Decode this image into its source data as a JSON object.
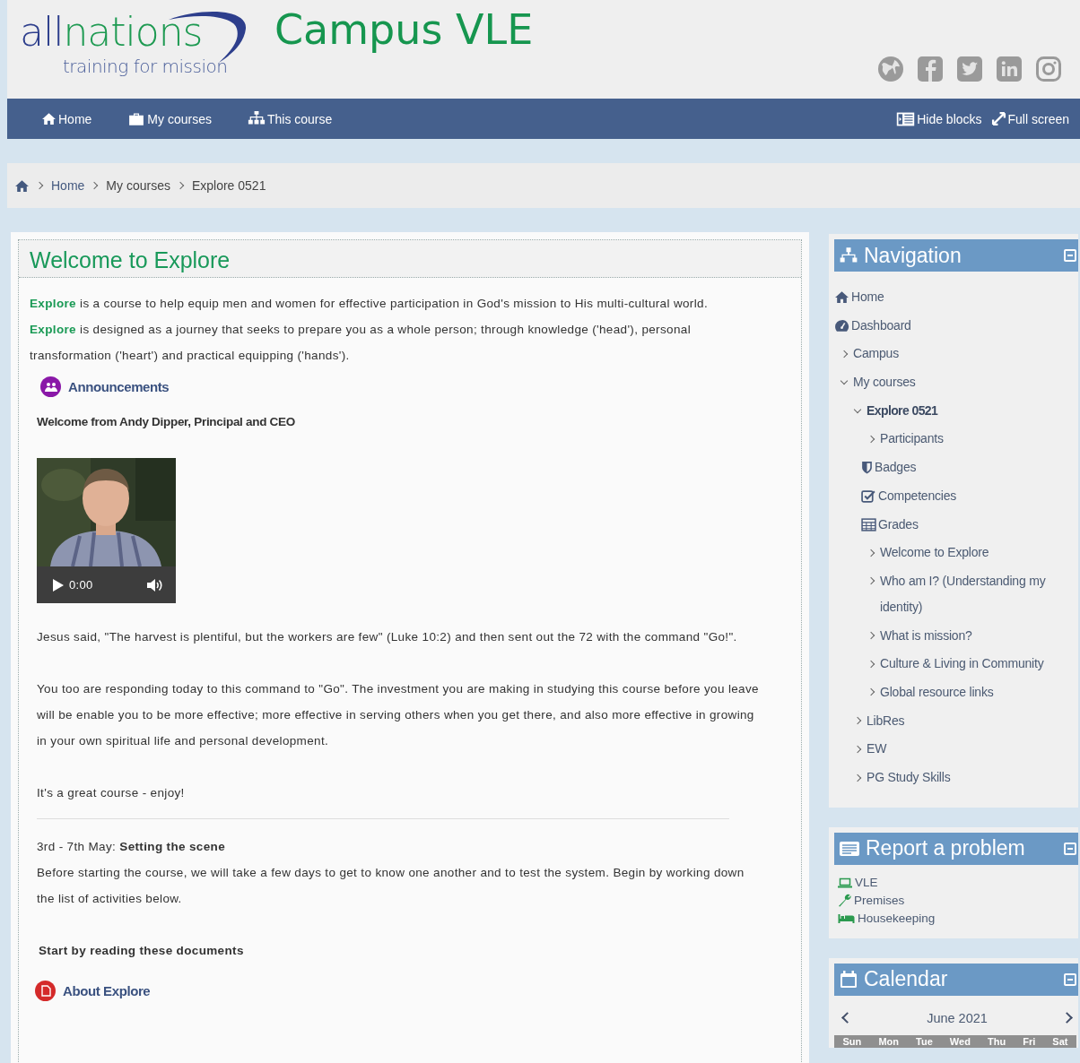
{
  "header": {
    "logo_first": "all",
    "logo_second": "nations",
    "tagline": "training for mission",
    "site_title": "Campus VLE"
  },
  "navbar": {
    "left": [
      {
        "label": "Home",
        "kind": "home"
      },
      {
        "label": "My courses",
        "kind": "briefcase"
      },
      {
        "label": "This course",
        "kind": "sitemap"
      }
    ],
    "right": [
      {
        "label": "Hide blocks",
        "kind": "blocks"
      },
      {
        "label": "Full screen",
        "kind": "expand"
      }
    ]
  },
  "breadcrumb": [
    "Home",
    "My courses",
    "Explore 0521"
  ],
  "course": {
    "title": "Welcome to Explore",
    "intro": [
      "**Explore** is a course to help equip men and women for effective participation in God's mission to His multi-cultural world.",
      "**Explore** is designed as a journey that seeks to prepare you as a whole person; through knowledge ('head'), personal transformation ('heart') and practical equipping ('hands')."
    ],
    "announcements": "Announcements",
    "welcome_heading": "Welcome from Andy Dipper, Principal and CEO",
    "video": {
      "time": "0:00"
    },
    "paragraphs": [
      "Jesus said, \"The harvest is plentiful, but the workers are few\" (Luke 10:2) and then sent out the 72 with the command \"Go!\".",
      "You too are responding today to this command to \"Go\".  The investment you are making in studying this course before you leave will be enable you to be more effective; more effective in serving others when you get there, and also more effective in growing in your own spiritual life and personal development.",
      "It's a great course - enjoy!"
    ],
    "section_heading": "3rd - 7th May: **Setting the scene**",
    "section_text": "Before starting the course, we will take a few days to get to know one another and to test the system. Begin by working down the list of activities below.",
    "start_heading": "Start by reading these documents",
    "document": "About Explore"
  },
  "navigation": {
    "title": "Navigation",
    "items": [
      {
        "label": "Home",
        "kind": "home",
        "selected": false
      },
      {
        "label": "Dashboard",
        "kind": "dashboard",
        "selected": false
      },
      {
        "label": "Campus",
        "kind": "branch",
        "expanded": false,
        "selected": false
      },
      {
        "label": "My courses",
        "kind": "branch",
        "expanded": true,
        "selected": false,
        "children": [
          {
            "label": "Explore 0521",
            "kind": "branch",
            "expanded": true,
            "selected": true,
            "children": [
              {
                "label": "Participants",
                "kind": "branch",
                "expanded": false,
                "selected": false
              },
              {
                "label": "Badges",
                "kind": "badges",
                "selected": false
              },
              {
                "label": "Competencies",
                "kind": "competencies",
                "selected": false
              },
              {
                "label": "Grades",
                "kind": "grades",
                "selected": false
              },
              {
                "label": "Welcome to Explore",
                "kind": "branch",
                "expanded": false,
                "selected": false
              },
              {
                "label": "Who am I? (Understanding my identity)",
                "kind": "branch",
                "expanded": false,
                "selected": false
              },
              {
                "label": "What is mission?",
                "kind": "branch",
                "expanded": false,
                "selected": false
              },
              {
                "label": "Culture & Living in Community",
                "kind": "branch",
                "expanded": false,
                "selected": false
              },
              {
                "label": "Global resource links",
                "kind": "branch",
                "expanded": false,
                "selected": false
              }
            ]
          },
          {
            "label": "LibRes",
            "kind": "branch",
            "expanded": false,
            "selected": false
          },
          {
            "label": "EW",
            "kind": "branch",
            "expanded": false,
            "selected": false
          },
          {
            "label": "PG Study Skills",
            "kind": "branch",
            "expanded": false,
            "selected": false
          }
        ]
      }
    ]
  },
  "report": {
    "title": "Report a problem",
    "items": [
      {
        "label": "VLE",
        "kind": "laptop"
      },
      {
        "label": "Premises",
        "kind": "wrench"
      },
      {
        "label": "Housekeeping",
        "kind": "bed"
      }
    ]
  },
  "calendar": {
    "title": "Calendar",
    "month": "June 2021",
    "weekdays": [
      "Sun",
      "Mon",
      "Tue",
      "Wed",
      "Thu",
      "Fri",
      "Sat"
    ]
  }
}
